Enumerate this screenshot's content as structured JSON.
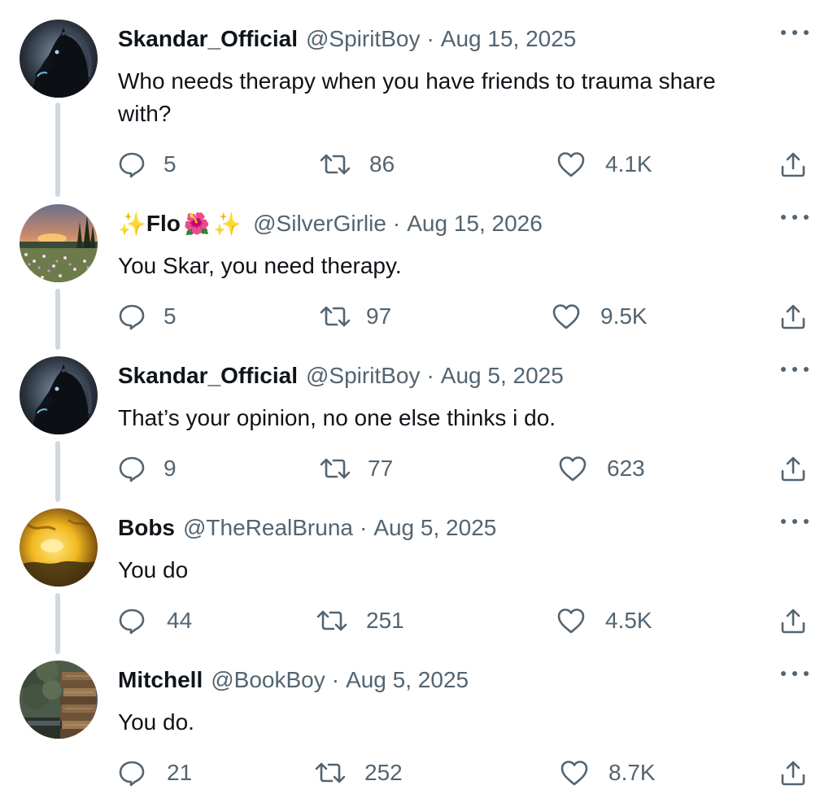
{
  "tweets": [
    {
      "name": "Skandar_Official",
      "handle": "@SpiritBoy",
      "date": "Aug 15, 2025",
      "text": "Who needs therapy when you have friends to trauma share with?",
      "replies": "5",
      "retweets": "86",
      "likes": "4.1K",
      "avatar": "black-horse-avatar"
    },
    {
      "name_prefix": "✨",
      "name": "Flo",
      "name_flower": "🌺",
      "name_suffix": "✨",
      "handle": "@SilverGirlie",
      "date": "Aug 15, 2026",
      "text": "You Skar, you need therapy.",
      "replies": "5",
      "retweets": "97",
      "likes": "9.5K",
      "avatar": "flower-meadow-sunset-avatar"
    },
    {
      "name": "Skandar_Official",
      "handle": "@SpiritBoy",
      "date": "Aug 5, 2025",
      "text": "That’s your opinion, no one else thinks i do.",
      "replies": "9",
      "retweets": "77",
      "likes": "623",
      "avatar": "black-horse-avatar"
    },
    {
      "name": "Bobs",
      "handle": "@TheRealBruna",
      "date": "Aug 5, 2025",
      "text": "You do",
      "replies": "44",
      "retweets": "251",
      "likes": "4.5K",
      "avatar": "golden-sky-avatar"
    },
    {
      "name": "Mitchell",
      "handle": "@BookBoy",
      "date": "Aug 5, 2025",
      "text": "You do.",
      "replies": "21",
      "retweets": "252",
      "likes": "8.7K",
      "avatar": "book-stack-forest-avatar"
    }
  ],
  "icons": {
    "reply": "reply-icon",
    "retweet": "retweet-icon",
    "like": "heart-icon",
    "share": "share-icon",
    "more": "more-options-icon"
  },
  "colors": {
    "text_primary": "#0f1419",
    "text_secondary": "#536471",
    "thread_line": "#cfd9de"
  }
}
